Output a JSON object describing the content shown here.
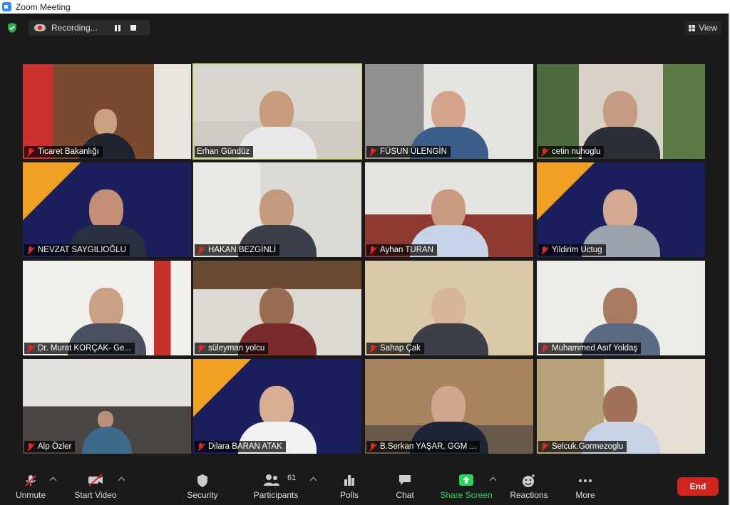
{
  "window": {
    "title": "Zoom Meeting"
  },
  "top": {
    "recording_label": "Recording...",
    "view_label": "View"
  },
  "participants": [
    {
      "name": "Ticaret Bakanlığı"
    },
    {
      "name": "Erhan Gündüz"
    },
    {
      "name": "FÜSUN ÜLENGİN"
    },
    {
      "name": "cetin nuhoglu"
    },
    {
      "name": "NEVZAT SAYGILIOĞLU"
    },
    {
      "name": "HAKAN BEZGİNLİ"
    },
    {
      "name": "Ayhan TURAN"
    },
    {
      "name": "Yildirim Uctug"
    },
    {
      "name": "Dr. Murat KORÇAK- Ge..."
    },
    {
      "name": "süleyman yolcu"
    },
    {
      "name": "Sahap Çak"
    },
    {
      "name": "Muhammed Asıf Yoldaş"
    },
    {
      "name": "Alp Özler"
    },
    {
      "name": "Dilara BARAN ATAK"
    },
    {
      "name": "B.Serkan YAŞAR, GGM ..."
    },
    {
      "name": "Selcuk.Gormezoglu"
    }
  ],
  "toolbar": {
    "unmute": "Unmute",
    "start_video": "Start Video",
    "security": "Security",
    "participants": "Participants",
    "participants_count": "61",
    "polls": "Polls",
    "chat": "Chat",
    "share_screen": "Share Screen",
    "reactions": "Reactions",
    "more": "More",
    "end": "End"
  },
  "colors": {
    "accent_green": "#23d959",
    "end_red": "#d3251f",
    "active_speaker": "#c6e63a"
  }
}
